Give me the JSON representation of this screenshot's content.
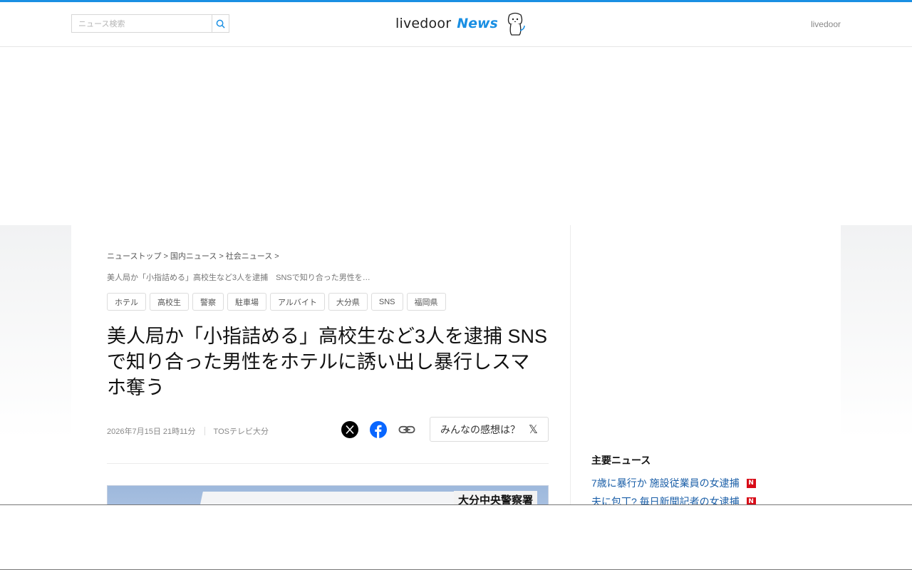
{
  "header": {
    "search_placeholder": "ニュース検索",
    "logo_word1": "livedoor",
    "logo_word2": "News",
    "right_link": "livedoor"
  },
  "breadcrumb": {
    "items": [
      "ニューストップ",
      "国内ニュース",
      "社会ニュース"
    ],
    "separator": ">",
    "current": "美人局か「小指詰める」高校生など3人を逮捕　SNSで知り合った男性を…"
  },
  "tags": [
    "ホテル",
    "高校生",
    "警察",
    "駐車場",
    "アルバイト",
    "大分県",
    "SNS",
    "福岡県"
  ],
  "article": {
    "title": "美人局か「小指詰める」高校生など3人を逮捕 SNSで知り合った男性をホテルに誘い出し暴行しスマホ奪う",
    "date": "2026年7月15日 21時11分",
    "source": "TOSテレビ大分",
    "photo_caption": "大分中央警察署"
  },
  "share": {
    "icons": [
      "x-icon",
      "facebook-icon",
      "link-icon"
    ],
    "kanso_label": "みんなの感想は？",
    "kanso_x": "𝕏"
  },
  "sidebar": {
    "title": "主要ニュース",
    "items": [
      {
        "text": "7歳に暴行か 施設従業員の女逮捕",
        "badge": "N"
      },
      {
        "text": "夫に包丁? 毎日新聞記者の女逮捕",
        "badge": "N"
      }
    ]
  },
  "colors": {
    "accent": "#1a8fe3",
    "link": "#1b5fa8",
    "badge": "#d80c18"
  }
}
